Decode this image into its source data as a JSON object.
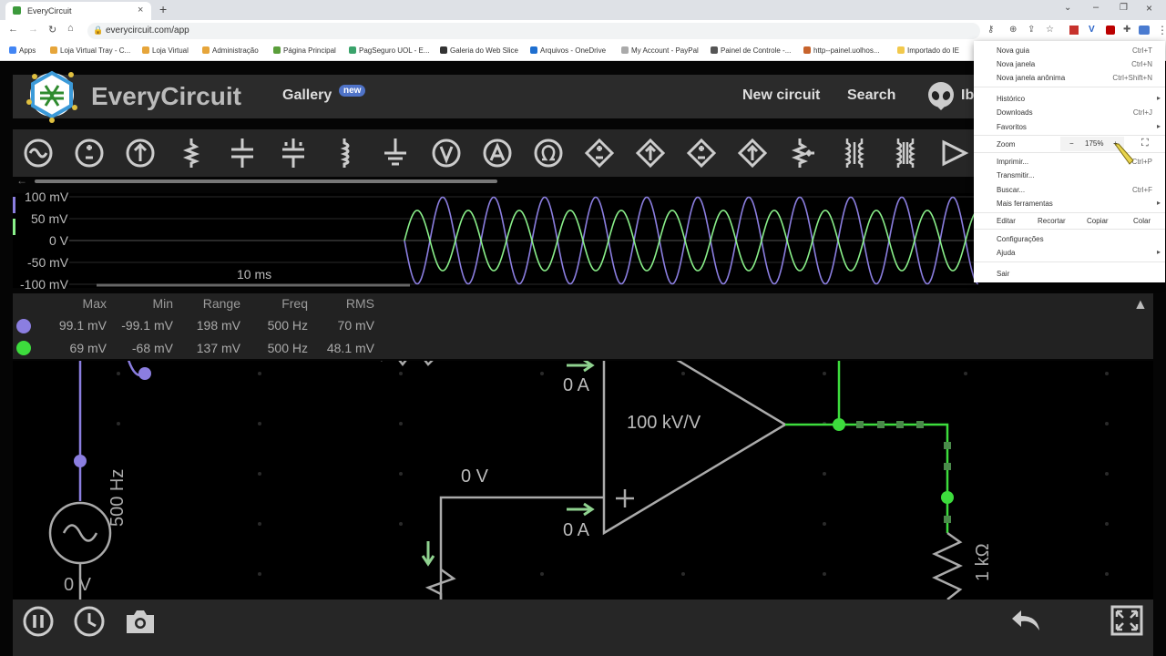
{
  "browser": {
    "tab_title": "EveryCircuit",
    "url": "everycircuit.com/app",
    "bookmarks": [
      "Apps",
      "Loja Virtual Tray - C...",
      "Loja Virtual",
      "Administração",
      "Página Principal",
      "PagSeguro UOL - E...",
      "Galeria do Web Slice",
      "Arquivos - OneDrive",
      "My Account - PayPal",
      "Painel de Controle -...",
      "http--painel.uolhos...",
      "Importado do IE"
    ]
  },
  "app": {
    "brand": "EveryCircuit",
    "gallery_label": "Gallery",
    "new_badge": "new",
    "new_circuit_label": "New circuit",
    "search_label": "Search",
    "user_initial": "Ib"
  },
  "scope": {
    "y_labels": [
      "100 mV",
      "50 mV",
      "0 V",
      "-50 mV",
      "-100 mV"
    ],
    "time_label": "10 ms",
    "series": [
      {
        "color": "#8b7ee0",
        "amplitude_mv": 99.1
      },
      {
        "color": "#8af08a",
        "amplitude_mv": 69
      }
    ]
  },
  "stats": {
    "headers": [
      "Max",
      "Min",
      "Range",
      "Freq",
      "RMS"
    ],
    "rows": [
      {
        "color": "#8b7ee0",
        "values": [
          "99.1 mV",
          "-99.1 mV",
          "198 mV",
          "500 Hz",
          "70 mV"
        ]
      },
      {
        "color": "#3ddc3d",
        "values": [
          "69 mV",
          "-68 mV",
          "137 mV",
          "500 Hz",
          "48.1 mV"
        ]
      }
    ]
  },
  "circuit": {
    "source_freq": "500 Hz",
    "source_voltage": "0 V",
    "opamp_gain": "100 kV/V",
    "current_top": "0 A",
    "current_bottom": "0 A",
    "node_voltage": "0 V",
    "resistor_load": "1 kΩ"
  },
  "menu": {
    "items": [
      {
        "label": "Nova guia",
        "shortcut": "Ctrl+T"
      },
      {
        "label": "Nova janela",
        "shortcut": "Ctrl+N"
      },
      {
        "label": "Nova janela anônima",
        "shortcut": "Ctrl+Shift+N"
      },
      {
        "label": "Histórico",
        "shortcut": ""
      },
      {
        "label": "Downloads",
        "shortcut": "Ctrl+J"
      },
      {
        "label": "Favoritos",
        "shortcut": ""
      },
      {
        "label": "Imprimir...",
        "shortcut": "Ctrl+P"
      },
      {
        "label": "Transmitir...",
        "shortcut": ""
      },
      {
        "label": "Buscar...",
        "shortcut": "Ctrl+F"
      },
      {
        "label": "Mais ferramentas",
        "shortcut": ""
      },
      {
        "label": "Configurações",
        "shortcut": ""
      },
      {
        "label": "Ajuda",
        "shortcut": ""
      },
      {
        "label": "Sair",
        "shortcut": ""
      }
    ],
    "zoom_label": "Zoom",
    "zoom_value": "175%",
    "zoom_minus": "−",
    "zoom_plus": "+",
    "edit_row": [
      "Editar",
      "Recortar",
      "Copiar",
      "Colar"
    ]
  }
}
